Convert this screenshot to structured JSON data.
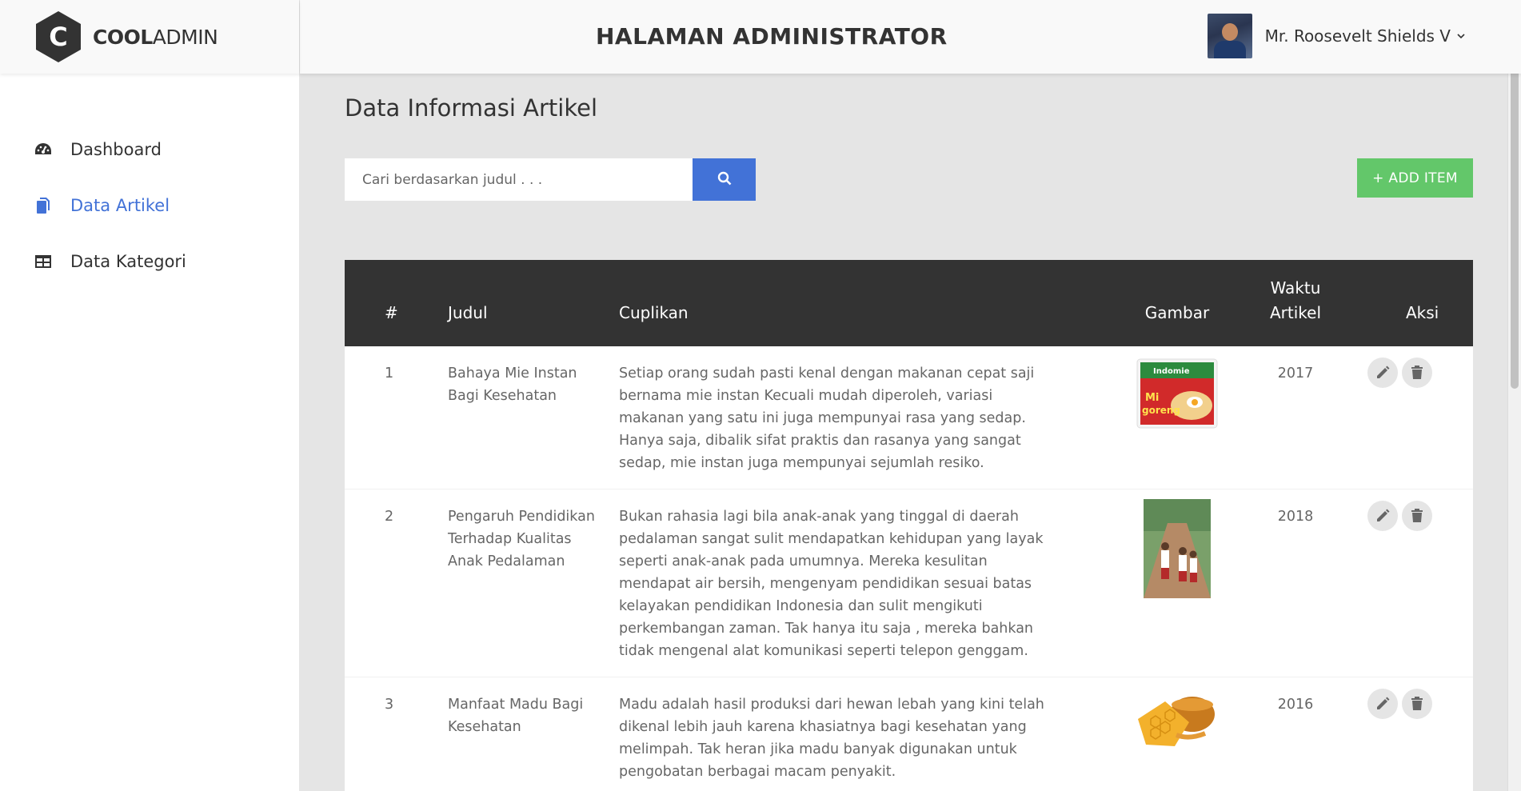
{
  "logo": {
    "bold": "COOL",
    "light": "ADMIN",
    "letter": "C"
  },
  "sidebar": {
    "items": [
      {
        "label": "Dashboard",
        "icon": "tachometer-icon",
        "active": false
      },
      {
        "label": "Data Artikel",
        "icon": "copy-icon",
        "active": true
      },
      {
        "label": "Data Kategori",
        "icon": "table-icon",
        "active": false
      }
    ]
  },
  "header": {
    "title": "HALAMAN ADMINISTRATOR",
    "user_name": "Mr. Roosevelt Shields V"
  },
  "main": {
    "page_title": "Data Informasi Artikel",
    "search_placeholder": "Cari berdasarkan judul . . .",
    "add_label": "+ ADD ITEM"
  },
  "table": {
    "headers": {
      "num": "#",
      "judul": "Judul",
      "cuplikan": "Cuplikan",
      "gambar": "Gambar",
      "waktu_line1": "Waktu",
      "waktu_line2": "Artikel",
      "aksi": "Aksi"
    },
    "rows": [
      {
        "num": "1",
        "judul": "Bahaya Mie Instan Bagi Kesehatan",
        "cuplikan": "Setiap orang sudah pasti kenal dengan makanan cepat saji bernama mie instan Kecuali mudah diperoleh, variasi makanan yang satu ini juga mempunyai rasa yang sedap. Hanya saja, dibalik sifat praktis dan rasanya yang sangat sedap, mie instan juga mempunyai sejumlah resiko.",
        "waktu": "2017",
        "image": "instant-noodle-image"
      },
      {
        "num": "2",
        "judul": "Pengaruh Pendidikan Terhadap Kualitas Anak Pedalaman",
        "cuplikan": "Bukan rahasia lagi bila anak-anak yang tinggal di daerah pedalaman sangat sulit mendapatkan kehidupan yang layak seperti anak-anak pada umumnya. Mereka kesulitan mendapat air bersih, mengenyam pendidikan sesuai batas kelayakan pendidikan Indonesia dan sulit mengikuti perkembangan zaman. Tak hanya itu saja , mereka bahkan tidak mengenal alat komunikasi seperti telepon genggam.",
        "waktu": "2018",
        "image": "children-road-image"
      },
      {
        "num": "3",
        "judul": "Manfaat Madu Bagi Kesehatan",
        "cuplikan": "Madu adalah hasil produksi dari hewan lebah yang kini telah dikenal lebih jauh karena khasiatnya bagi kesehatan yang melimpah. Tak heran jika madu banyak digunakan untuk pengobatan berbagai macam penyakit.",
        "waktu": "2016",
        "image": "honey-image"
      }
    ]
  },
  "colors": {
    "accent": "#4272d7",
    "add_button": "#63c76a",
    "table_header": "#333333",
    "background": "#e5e5e5"
  }
}
